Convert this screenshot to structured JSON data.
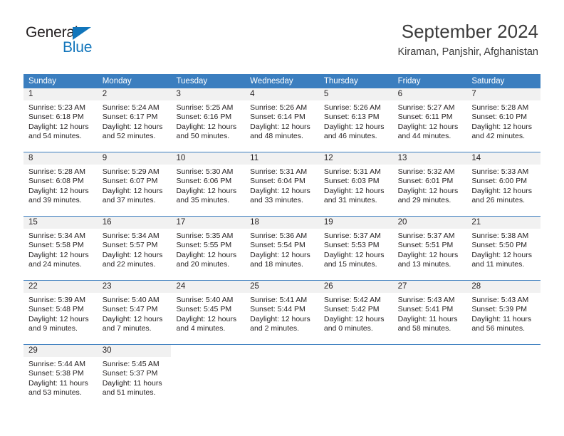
{
  "brand": {
    "name_top": "General",
    "name_bottom": "Blue",
    "accent_color": "#1175bb"
  },
  "header": {
    "title": "September 2024",
    "subtitle": "Kiraman, Panjshir, Afghanistan"
  },
  "theme": {
    "header_row_bg": "#3b7ebf",
    "daynum_band_bg": "#f1f1f1",
    "text_color": "#231f20"
  },
  "weekday_headers": [
    "Sunday",
    "Monday",
    "Tuesday",
    "Wednesday",
    "Thursday",
    "Friday",
    "Saturday"
  ],
  "weeks": [
    [
      {
        "day": "1",
        "sunrise": "Sunrise: 5:23 AM",
        "sunset": "Sunset: 6:18 PM",
        "daylight1": "Daylight: 12 hours",
        "daylight2": "and 54 minutes."
      },
      {
        "day": "2",
        "sunrise": "Sunrise: 5:24 AM",
        "sunset": "Sunset: 6:17 PM",
        "daylight1": "Daylight: 12 hours",
        "daylight2": "and 52 minutes."
      },
      {
        "day": "3",
        "sunrise": "Sunrise: 5:25 AM",
        "sunset": "Sunset: 6:16 PM",
        "daylight1": "Daylight: 12 hours",
        "daylight2": "and 50 minutes."
      },
      {
        "day": "4",
        "sunrise": "Sunrise: 5:26 AM",
        "sunset": "Sunset: 6:14 PM",
        "daylight1": "Daylight: 12 hours",
        "daylight2": "and 48 minutes."
      },
      {
        "day": "5",
        "sunrise": "Sunrise: 5:26 AM",
        "sunset": "Sunset: 6:13 PM",
        "daylight1": "Daylight: 12 hours",
        "daylight2": "and 46 minutes."
      },
      {
        "day": "6",
        "sunrise": "Sunrise: 5:27 AM",
        "sunset": "Sunset: 6:11 PM",
        "daylight1": "Daylight: 12 hours",
        "daylight2": "and 44 minutes."
      },
      {
        "day": "7",
        "sunrise": "Sunrise: 5:28 AM",
        "sunset": "Sunset: 6:10 PM",
        "daylight1": "Daylight: 12 hours",
        "daylight2": "and 42 minutes."
      }
    ],
    [
      {
        "day": "8",
        "sunrise": "Sunrise: 5:28 AM",
        "sunset": "Sunset: 6:08 PM",
        "daylight1": "Daylight: 12 hours",
        "daylight2": "and 39 minutes."
      },
      {
        "day": "9",
        "sunrise": "Sunrise: 5:29 AM",
        "sunset": "Sunset: 6:07 PM",
        "daylight1": "Daylight: 12 hours",
        "daylight2": "and 37 minutes."
      },
      {
        "day": "10",
        "sunrise": "Sunrise: 5:30 AM",
        "sunset": "Sunset: 6:06 PM",
        "daylight1": "Daylight: 12 hours",
        "daylight2": "and 35 minutes."
      },
      {
        "day": "11",
        "sunrise": "Sunrise: 5:31 AM",
        "sunset": "Sunset: 6:04 PM",
        "daylight1": "Daylight: 12 hours",
        "daylight2": "and 33 minutes."
      },
      {
        "day": "12",
        "sunrise": "Sunrise: 5:31 AM",
        "sunset": "Sunset: 6:03 PM",
        "daylight1": "Daylight: 12 hours",
        "daylight2": "and 31 minutes."
      },
      {
        "day": "13",
        "sunrise": "Sunrise: 5:32 AM",
        "sunset": "Sunset: 6:01 PM",
        "daylight1": "Daylight: 12 hours",
        "daylight2": "and 29 minutes."
      },
      {
        "day": "14",
        "sunrise": "Sunrise: 5:33 AM",
        "sunset": "Sunset: 6:00 PM",
        "daylight1": "Daylight: 12 hours",
        "daylight2": "and 26 minutes."
      }
    ],
    [
      {
        "day": "15",
        "sunrise": "Sunrise: 5:34 AM",
        "sunset": "Sunset: 5:58 PM",
        "daylight1": "Daylight: 12 hours",
        "daylight2": "and 24 minutes."
      },
      {
        "day": "16",
        "sunrise": "Sunrise: 5:34 AM",
        "sunset": "Sunset: 5:57 PM",
        "daylight1": "Daylight: 12 hours",
        "daylight2": "and 22 minutes."
      },
      {
        "day": "17",
        "sunrise": "Sunrise: 5:35 AM",
        "sunset": "Sunset: 5:55 PM",
        "daylight1": "Daylight: 12 hours",
        "daylight2": "and 20 minutes."
      },
      {
        "day": "18",
        "sunrise": "Sunrise: 5:36 AM",
        "sunset": "Sunset: 5:54 PM",
        "daylight1": "Daylight: 12 hours",
        "daylight2": "and 18 minutes."
      },
      {
        "day": "19",
        "sunrise": "Sunrise: 5:37 AM",
        "sunset": "Sunset: 5:53 PM",
        "daylight1": "Daylight: 12 hours",
        "daylight2": "and 15 minutes."
      },
      {
        "day": "20",
        "sunrise": "Sunrise: 5:37 AM",
        "sunset": "Sunset: 5:51 PM",
        "daylight1": "Daylight: 12 hours",
        "daylight2": "and 13 minutes."
      },
      {
        "day": "21",
        "sunrise": "Sunrise: 5:38 AM",
        "sunset": "Sunset: 5:50 PM",
        "daylight1": "Daylight: 12 hours",
        "daylight2": "and 11 minutes."
      }
    ],
    [
      {
        "day": "22",
        "sunrise": "Sunrise: 5:39 AM",
        "sunset": "Sunset: 5:48 PM",
        "daylight1": "Daylight: 12 hours",
        "daylight2": "and 9 minutes."
      },
      {
        "day": "23",
        "sunrise": "Sunrise: 5:40 AM",
        "sunset": "Sunset: 5:47 PM",
        "daylight1": "Daylight: 12 hours",
        "daylight2": "and 7 minutes."
      },
      {
        "day": "24",
        "sunrise": "Sunrise: 5:40 AM",
        "sunset": "Sunset: 5:45 PM",
        "daylight1": "Daylight: 12 hours",
        "daylight2": "and 4 minutes."
      },
      {
        "day": "25",
        "sunrise": "Sunrise: 5:41 AM",
        "sunset": "Sunset: 5:44 PM",
        "daylight1": "Daylight: 12 hours",
        "daylight2": "and 2 minutes."
      },
      {
        "day": "26",
        "sunrise": "Sunrise: 5:42 AM",
        "sunset": "Sunset: 5:42 PM",
        "daylight1": "Daylight: 12 hours",
        "daylight2": "and 0 minutes."
      },
      {
        "day": "27",
        "sunrise": "Sunrise: 5:43 AM",
        "sunset": "Sunset: 5:41 PM",
        "daylight1": "Daylight: 11 hours",
        "daylight2": "and 58 minutes."
      },
      {
        "day": "28",
        "sunrise": "Sunrise: 5:43 AM",
        "sunset": "Sunset: 5:39 PM",
        "daylight1": "Daylight: 11 hours",
        "daylight2": "and 56 minutes."
      }
    ],
    [
      {
        "day": "29",
        "sunrise": "Sunrise: 5:44 AM",
        "sunset": "Sunset: 5:38 PM",
        "daylight1": "Daylight: 11 hours",
        "daylight2": "and 53 minutes."
      },
      {
        "day": "30",
        "sunrise": "Sunrise: 5:45 AM",
        "sunset": "Sunset: 5:37 PM",
        "daylight1": "Daylight: 11 hours",
        "daylight2": "and 51 minutes."
      },
      {
        "day": "",
        "sunrise": "",
        "sunset": "",
        "daylight1": "",
        "daylight2": ""
      },
      {
        "day": "",
        "sunrise": "",
        "sunset": "",
        "daylight1": "",
        "daylight2": ""
      },
      {
        "day": "",
        "sunrise": "",
        "sunset": "",
        "daylight1": "",
        "daylight2": ""
      },
      {
        "day": "",
        "sunrise": "",
        "sunset": "",
        "daylight1": "",
        "daylight2": ""
      },
      {
        "day": "",
        "sunrise": "",
        "sunset": "",
        "daylight1": "",
        "daylight2": ""
      }
    ]
  ]
}
